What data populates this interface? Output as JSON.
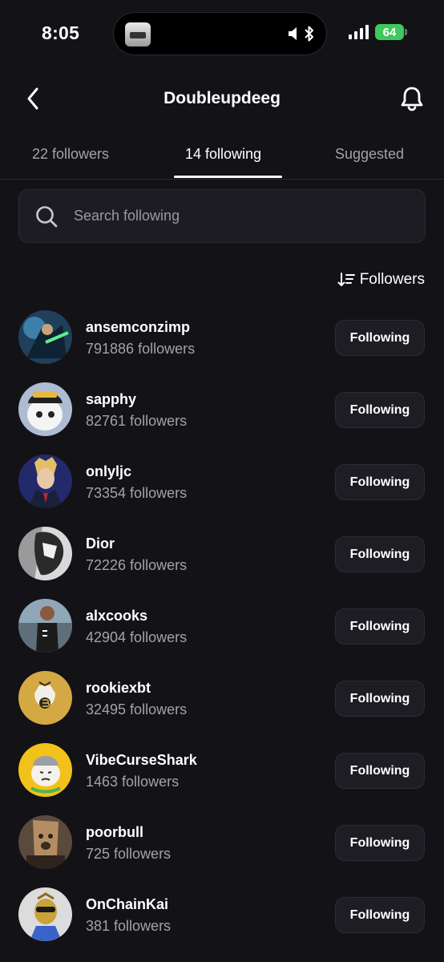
{
  "status_bar": {
    "time": "8:05",
    "battery": "64"
  },
  "header": {
    "title": "Doubleupdeeg"
  },
  "tabs": [
    {
      "label": "22 followers"
    },
    {
      "label": "14 following"
    },
    {
      "label": "Suggested"
    }
  ],
  "search": {
    "placeholder": "Search following"
  },
  "sort": {
    "label": "Followers"
  },
  "following": [
    {
      "name": "ansemconzimp",
      "followers": "791886 followers",
      "button": "Following"
    },
    {
      "name": "sapphy",
      "followers": "82761 followers",
      "button": "Following"
    },
    {
      "name": "onlyljc",
      "followers": "73354 followers",
      "button": "Following"
    },
    {
      "name": "Dior",
      "followers": "72226 followers",
      "button": "Following"
    },
    {
      "name": "alxcooks",
      "followers": "42904 followers",
      "button": "Following"
    },
    {
      "name": "rookiexbt",
      "followers": "32495 followers",
      "button": "Following"
    },
    {
      "name": "VibeCurseShark",
      "followers": "1463 followers",
      "button": "Following"
    },
    {
      "name": "poorbull",
      "followers": "725 followers",
      "button": "Following"
    },
    {
      "name": "OnChainKai",
      "followers": "381 followers",
      "button": "Following"
    }
  ]
}
